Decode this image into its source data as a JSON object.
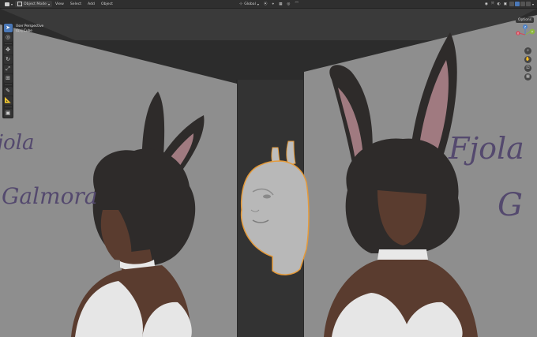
{
  "header": {
    "mode_label": "Object Mode",
    "menus": [
      "View",
      "Select",
      "Add",
      "Object"
    ],
    "transform_orientation": "Global"
  },
  "viewport": {
    "view_name": "User Perspective",
    "active_object": "(1) | Cube"
  },
  "options_label": "Options",
  "gizmo": {
    "x_label": "X",
    "y_label": "Y",
    "z_label": "Z"
  },
  "reference_text": {
    "left_line1": "jola",
    "left_line2": "Galmora",
    "right_line1": "Fjola",
    "right_line2": "G"
  },
  "colors": {
    "header_bg": "#2f2f2f",
    "viewport_dark": "#2c2c2c",
    "wall_gray": "#8e8e8e",
    "selection_outline": "#e59a39",
    "skin": "#5a3c2f",
    "hair": "#2e2b2a",
    "ear_inner": "#a07a80",
    "sketch_ink": "#54496e",
    "accent_blue": "#4a78b8"
  }
}
